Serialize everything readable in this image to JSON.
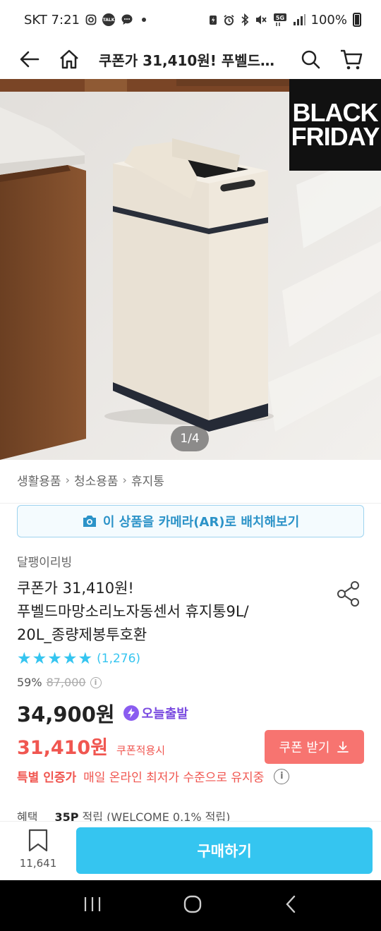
{
  "status_bar": {
    "carrier_time": "SKT 7:21",
    "talk_label": "TALK",
    "battery": "100%",
    "network": "5G"
  },
  "app_bar": {
    "title": "쿠폰가 31,410원! 푸벨드마망소리노자동센서 휴지통9L/20L_종량제봉투호환"
  },
  "hero": {
    "badge_line1": "BLACK",
    "badge_line2": "FRIDAY",
    "page_indicator": "1/4"
  },
  "breadcrumb": [
    "생활용품",
    "청소용품",
    "휴지통"
  ],
  "ar_button": {
    "label": "이 상품을 카메라(AR)로 배치해보기"
  },
  "product": {
    "brand": "달팽이리빙",
    "title_lines": [
      "쿠폰가 31,410원!",
      "푸벨드마망소리노자동센서 휴지통9L/",
      "20L_종량제봉투호환"
    ],
    "rating_stars": 5,
    "review_count": "(1,276)",
    "discount_rate": "59%",
    "original_price": "87,000",
    "price": "34,900원",
    "today_delivery": "오늘출발",
    "coupon_price": "31,410원",
    "coupon_price_label": "쿠폰적용시",
    "coupon_button": "쿠폰 받기",
    "special_label": "특별 인증가",
    "special_text": "매일 온라인 최저가 수준으로 유지중",
    "benefit_label": "혜택",
    "benefit_points": "35P",
    "benefit_text": "적립 (WELCOME 0.1% 적립)"
  },
  "buy_bar": {
    "bookmark_count": "11,641",
    "buy_label": "구매하기"
  },
  "colors": {
    "accent": "#35c5f0",
    "coupon_red": "#f05650",
    "coupon_button": "#f77470",
    "today_purple": "#7a4be0"
  },
  "icons": {
    "back": "arrow-left-icon",
    "home": "home-icon",
    "search": "search-icon",
    "cart": "cart-icon",
    "camera": "camera-icon",
    "share": "share-icon",
    "bookmark": "bookmark-icon",
    "download": "download-icon",
    "info": "info-icon"
  }
}
